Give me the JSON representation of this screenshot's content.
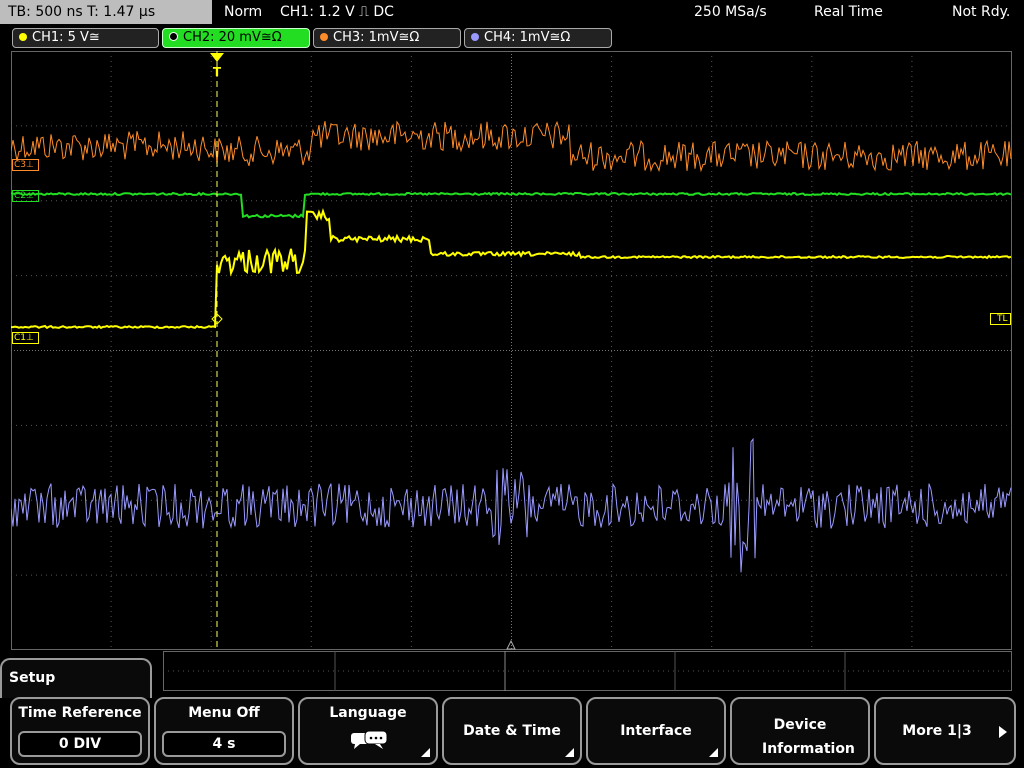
{
  "status": {
    "timebase": "TB: 500 ns   T: 1.47 µs",
    "mode": "Norm",
    "trigger": "CH1: 1.2 V ⎍ DC",
    "sample_rate": "250 MSa/s",
    "acquisition": "Real Time",
    "state": "Not Rdy."
  },
  "channels": [
    {
      "label": "CH1: 5 V≅",
      "color": "#ffff00"
    },
    {
      "label": "CH2: 20 mV≅Ω",
      "color": "#00ff00"
    },
    {
      "label": "CH3: 1mV≅Ω",
      "color": "#ff8c2a"
    },
    {
      "label": "CH4: 1mV≅Ω",
      "color": "#9999ff"
    }
  ],
  "markers": {
    "c3": "C3⊥",
    "c2": "C2⊥",
    "c1": "C1⊥",
    "tl": "TL",
    "trigger": "T"
  },
  "menu": {
    "title": "Setup",
    "keys": [
      {
        "label": "Time Reference",
        "value": "0 DIV"
      },
      {
        "label": "Menu Off",
        "value": "4 s"
      },
      {
        "label": "Language",
        "icon": "speech-bubbles-icon"
      },
      {
        "label": "Date & Time"
      },
      {
        "label": "Interface"
      },
      {
        "label": "Device Information"
      },
      {
        "label": "More 1|3"
      }
    ]
  }
}
